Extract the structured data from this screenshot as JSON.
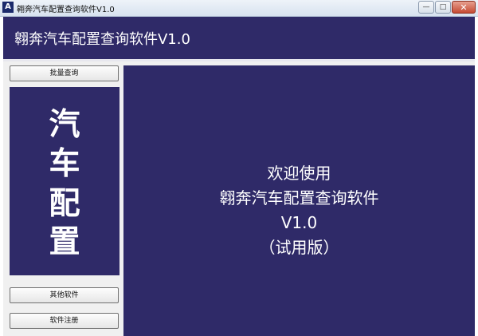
{
  "window": {
    "icon_label": "A",
    "title": "翱奔汽车配置查询软件V1.0",
    "controls": {
      "minimize": "—",
      "maximize": "□",
      "close": "✕"
    }
  },
  "header": {
    "title": "翱奔汽车配置查询软件V1.0"
  },
  "sidebar": {
    "batch_query_label": "批量查询",
    "vertical_title": [
      "汽",
      "车",
      "配",
      "置"
    ],
    "other_software_label": "其他软件",
    "register_label": "软件注册"
  },
  "main": {
    "lines": [
      "欢迎使用",
      "翱奔汽车配置查询软件",
      "V1.0",
      "（试用版）"
    ]
  },
  "colors": {
    "panel_background": "#2f2a68",
    "text": "#ffffff"
  }
}
